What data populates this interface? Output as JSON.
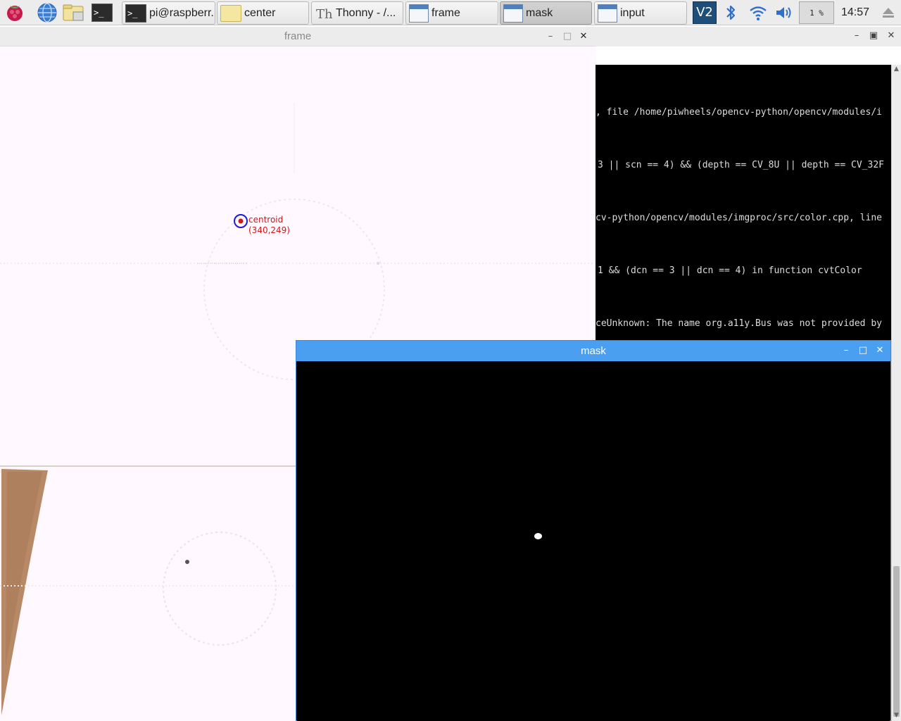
{
  "taskbar": {
    "launchers": [
      {
        "name": "raspberry-menu-icon"
      },
      {
        "name": "web-browser-icon"
      },
      {
        "name": "file-manager-icon"
      },
      {
        "name": "terminal-icon"
      }
    ],
    "tasks": [
      {
        "label": "pi@raspberr...",
        "icon": "terminal-icon",
        "active": false
      },
      {
        "label": "center",
        "icon": "folder-icon",
        "active": false
      },
      {
        "label": "Thonny  -  /...",
        "icon": "thonny-icon",
        "active": false
      },
      {
        "label": "frame",
        "icon": "window-icon",
        "active": false
      },
      {
        "label": "mask",
        "icon": "window-icon",
        "active": true
      },
      {
        "label": "input",
        "icon": "window-icon",
        "active": false
      }
    ],
    "tray": {
      "vnc_label": "V2",
      "cpu_usage": "1 %",
      "clock": "14:57"
    }
  },
  "terminal": {
    "lines": [
      ", file /home/piwheels/opencv-python/opencv/modules/i",
      "3 || scn == 4) && (depth == CV_8U || depth == CV_32F",
      "cv-python/opencv/modules/imgproc/src/color.cpp, line",
      "1 && (dcn == 3 || dcn == 4) in function cvtColor",
      "ceUnknown: The name org.a11y.Bus was not provided by"
    ]
  },
  "frame_window": {
    "title": "frame",
    "overlay": {
      "label": "centroid",
      "coords": "(340,249)"
    }
  },
  "mask_window": {
    "title": "mask"
  },
  "colors": {
    "mask_titlebar": "#4a9ff0",
    "centroid_ring": "#1a1ad8",
    "centroid_text": "#d01818"
  }
}
